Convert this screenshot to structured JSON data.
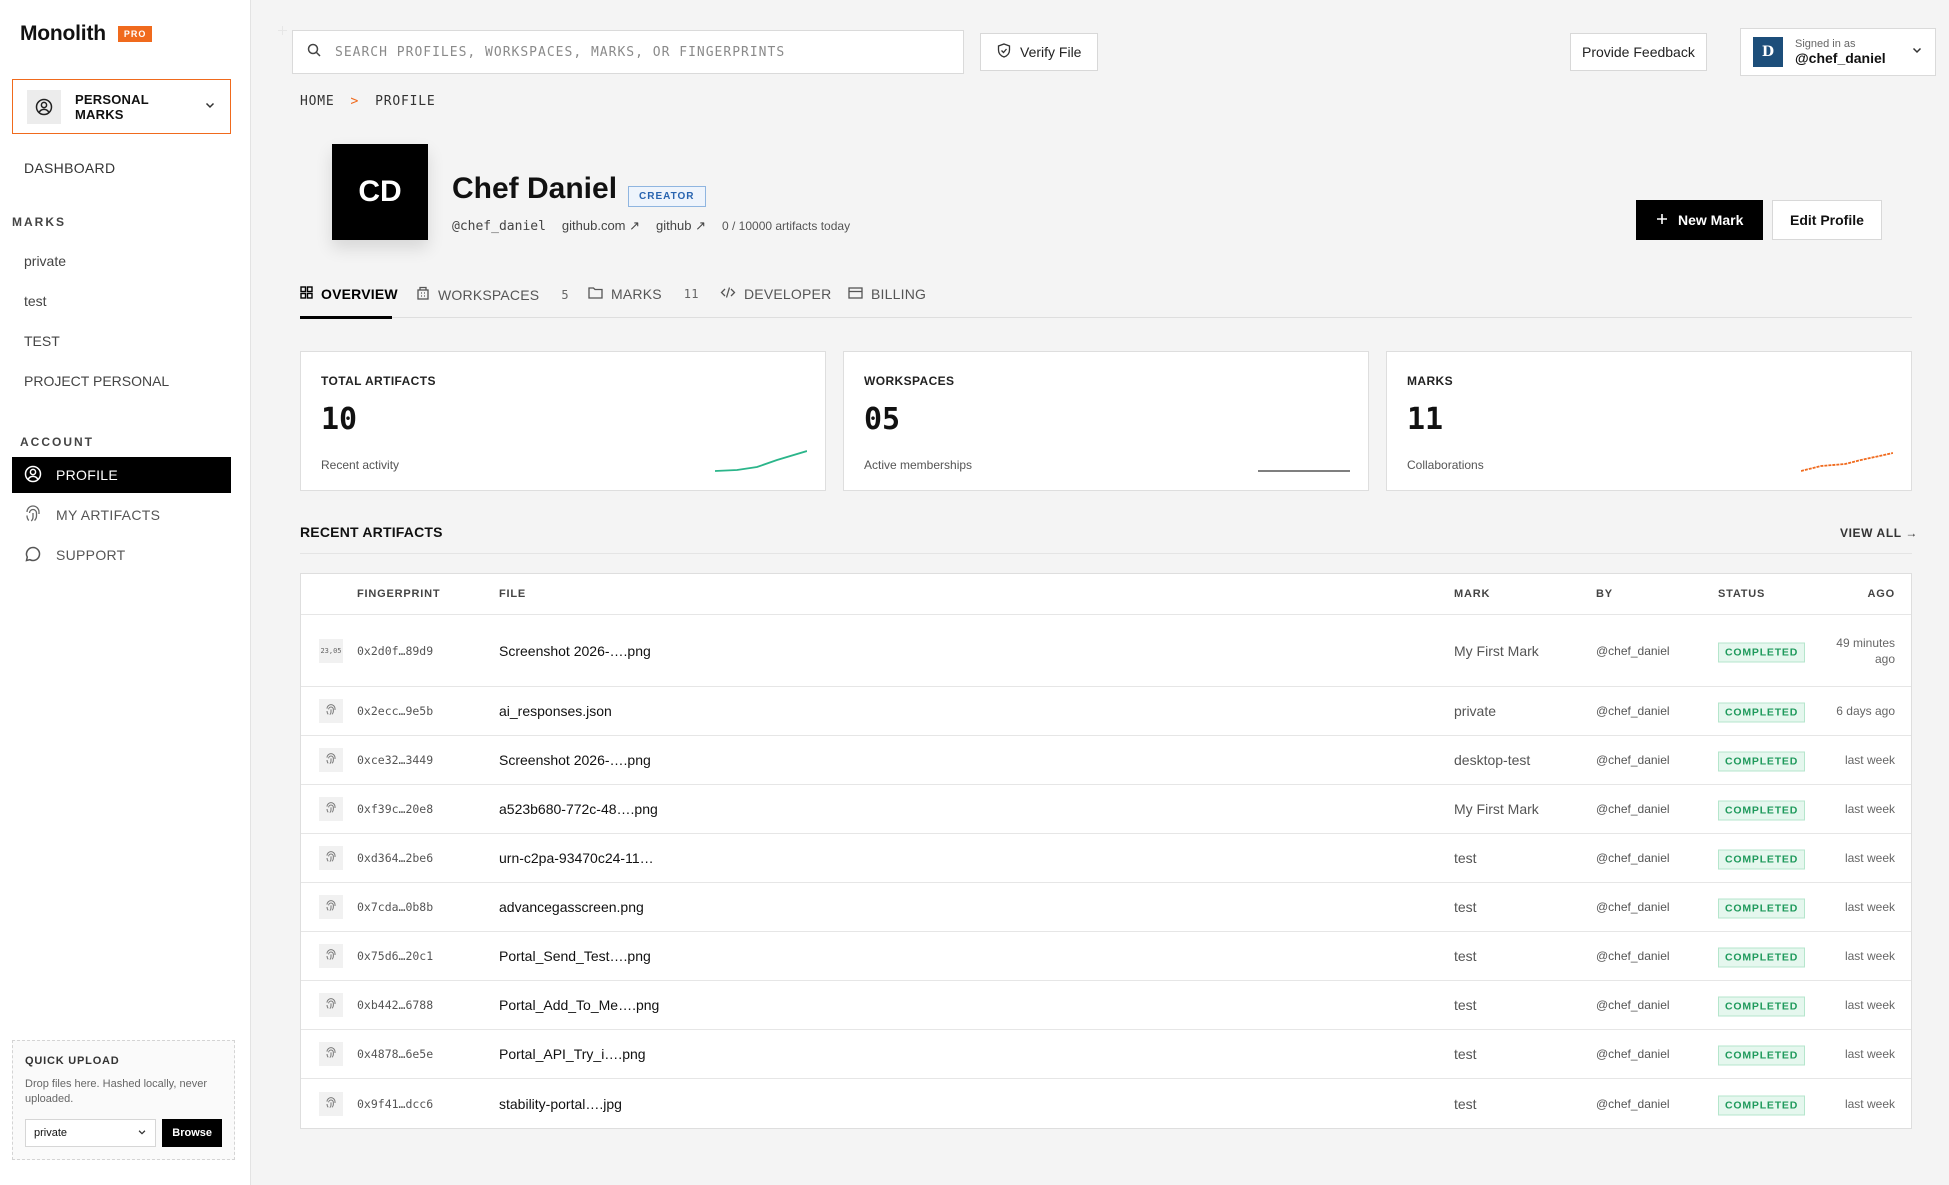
{
  "brand": {
    "name": "Monolith",
    "badge": "PRO"
  },
  "workspace_switch": {
    "label": "PERSONAL MARKS"
  },
  "sidebar": {
    "dashboard": "DASHBOARD",
    "marks_section": "MARKS",
    "marks": [
      "private",
      "test",
      "TEST",
      "PROJECT PERSONAL"
    ],
    "account_section": "ACCOUNT",
    "account": [
      {
        "label": "PROFILE",
        "icon": "user-circle-icon",
        "active": true
      },
      {
        "label": "MY ARTIFACTS",
        "icon": "fingerprint-icon",
        "active": false
      },
      {
        "label": "SUPPORT",
        "icon": "chat-bubble-icon",
        "active": false
      }
    ]
  },
  "quick_upload": {
    "title": "QUICK UPLOAD",
    "description": "Drop files here. Hashed locally, never uploaded.",
    "selected": "private",
    "browse": "Browse"
  },
  "topbar": {
    "search_placeholder": "SEARCH PROFILES, WORKSPACES, MARKS, OR FINGERPRINTS",
    "verify_label": "Verify File",
    "feedback_label": "Provide Feedback",
    "signed_in_caption": "Signed in as",
    "signed_in_user": "@chef_daniel",
    "avatar_letter": "D"
  },
  "breadcrumb": {
    "home": "HOME",
    "sep": ">",
    "current": "PROFILE"
  },
  "profile": {
    "initials": "CD",
    "name": "Chef Daniel",
    "role": "CREATOR",
    "handle": "@chef_daniel",
    "link1": "github.com",
    "link2": "github",
    "quota": "0 / 10000 artifacts today",
    "new_mark": "New Mark",
    "edit_profile": "Edit Profile"
  },
  "tabs": [
    {
      "label": "OVERVIEW",
      "icon": "grid-icon",
      "count": ""
    },
    {
      "label": "WORKSPACES",
      "icon": "building-icon",
      "count": "5"
    },
    {
      "label": "MARKS",
      "icon": "folder-icon",
      "count": "11"
    },
    {
      "label": "DEVELOPER",
      "icon": "code-icon",
      "count": ""
    },
    {
      "label": "BILLING",
      "icon": "card-icon",
      "count": ""
    }
  ],
  "stats": [
    {
      "label": "TOTAL ARTIFACTS",
      "value": "10",
      "sub": "Recent activity",
      "color": "#2bb58a"
    },
    {
      "label": "WORKSPACES",
      "value": "05",
      "sub": "Active memberships",
      "color": "#555555"
    },
    {
      "label": "MARKS",
      "value": "11",
      "sub": "Collaborations",
      "color": "#f06a1d"
    }
  ],
  "recent": {
    "title": "RECENT ARTIFACTS",
    "view_all": "VIEW ALL",
    "columns": [
      "FINGERPRINT",
      "FILE",
      "MARK",
      "BY",
      "STATUS",
      "AGO"
    ],
    "rows": [
      {
        "thumb": "23,05",
        "fp": "0x2d0f…89d9",
        "file": "Screenshot 2026-….png",
        "mark": "My First Mark",
        "by": "@chef_daniel",
        "status": "COMPLETED",
        "ago": "49 minutes ago"
      },
      {
        "thumb": "",
        "fp": "0x2ecc…9e5b",
        "file": "ai_responses.json",
        "mark": "private",
        "by": "@chef_daniel",
        "status": "COMPLETED",
        "ago": "6 days ago"
      },
      {
        "thumb": "",
        "fp": "0xce32…3449",
        "file": "Screenshot 2026-….png",
        "mark": "desktop-test",
        "by": "@chef_daniel",
        "status": "COMPLETED",
        "ago": "last week"
      },
      {
        "thumb": "",
        "fp": "0xf39c…20e8",
        "file": "a523b680-772c-48….png",
        "mark": "My First Mark",
        "by": "@chef_daniel",
        "status": "COMPLETED",
        "ago": "last week"
      },
      {
        "thumb": "",
        "fp": "0xd364…2be6",
        "file": "urn-c2pa-93470c24-11…",
        "mark": "test",
        "by": "@chef_daniel",
        "status": "COMPLETED",
        "ago": "last week"
      },
      {
        "thumb": "",
        "fp": "0x7cda…0b8b",
        "file": "advancegasscreen.png",
        "mark": "test",
        "by": "@chef_daniel",
        "status": "COMPLETED",
        "ago": "last week"
      },
      {
        "thumb": "",
        "fp": "0x75d6…20c1",
        "file": "Portal_Send_Test….png",
        "mark": "test",
        "by": "@chef_daniel",
        "status": "COMPLETED",
        "ago": "last week"
      },
      {
        "thumb": "",
        "fp": "0xb442…6788",
        "file": "Portal_Add_To_Me….png",
        "mark": "test",
        "by": "@chef_daniel",
        "status": "COMPLETED",
        "ago": "last week"
      },
      {
        "thumb": "",
        "fp": "0x4878…6e5e",
        "file": "Portal_API_Try_i….png",
        "mark": "test",
        "by": "@chef_daniel",
        "status": "COMPLETED",
        "ago": "last week"
      },
      {
        "thumb": "",
        "fp": "0x9f41…dcc6",
        "file": "stability-portal….jpg",
        "mark": "test",
        "by": "@chef_daniel",
        "status": "COMPLETED",
        "ago": "last week"
      }
    ]
  },
  "colors": {
    "accent": "#f06a1d",
    "success": "#1f9a5c",
    "avatar": "#1d4e7a"
  }
}
